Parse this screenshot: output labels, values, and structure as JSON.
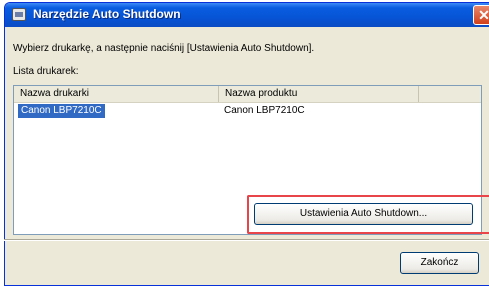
{
  "window": {
    "title": "Narzędzie Auto Shutdown",
    "close_glyph": "✕"
  },
  "instruction": "Wybierz drukarkę, a następnie naciśnij [Ustawienia Auto Shutdown].",
  "list": {
    "label": "Lista drukarek:",
    "columns": [
      "Nazwa drukarki",
      "Nazwa produktu"
    ],
    "rows": [
      {
        "printer": "Canon LBP7210C",
        "product": "Canon LBP7210C",
        "selected": true
      }
    ]
  },
  "buttons": {
    "settings": "Ustawienia Auto Shutdown...",
    "close": "Zakończ"
  },
  "colors": {
    "highlight": "#e8454a",
    "selection": "#316ac5"
  }
}
